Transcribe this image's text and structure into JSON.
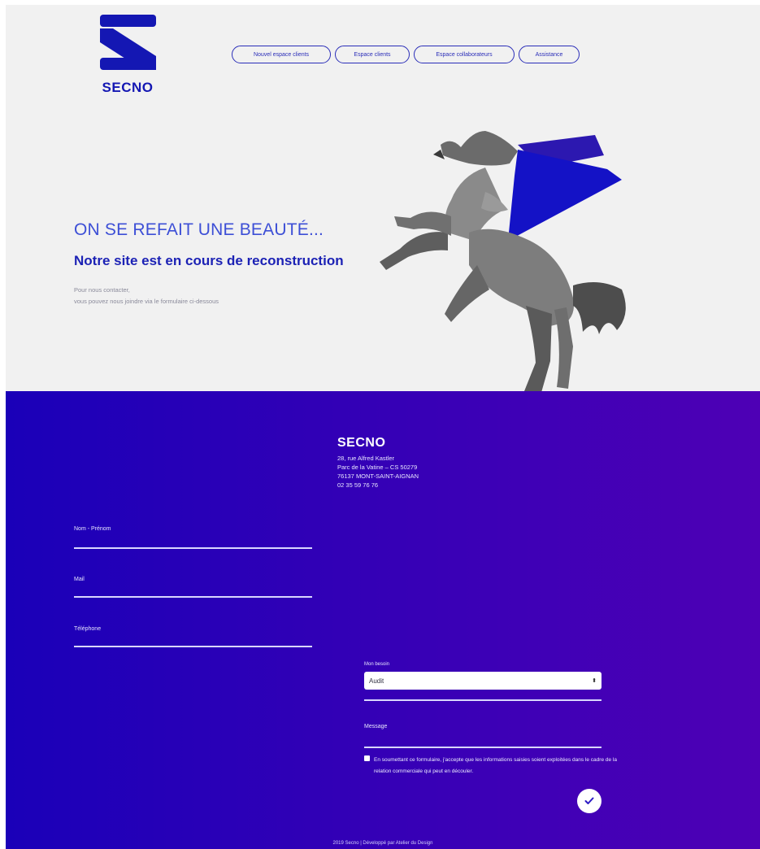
{
  "logo": {
    "text": "SECNO",
    "brand_color": "#1417b3"
  },
  "nav": {
    "items": [
      {
        "label": "Nouvel espace clients"
      },
      {
        "label": "Espace clients"
      },
      {
        "label": "Espace collaborateurs"
      },
      {
        "label": "Assistance"
      }
    ]
  },
  "hero": {
    "headline": "ON SE REFAIT UNE BEAUTÉ...",
    "subheadline": "Notre site est en cours de reconstruction",
    "intro_line1": "Pour nous contacter,",
    "intro_line2": "vous pouvez nous joindre via le formulaire ci-dessous"
  },
  "company": {
    "name": "SECNO",
    "address1": "28, rue Alfred Kastler",
    "address2": "Parc de la Vatine – CS 50279",
    "address3": "76137 MONT-SAINT-AIGNAN",
    "phone": "02 35 59 76 76"
  },
  "form": {
    "name_label": "Nom - Prénom",
    "mail_label": "Mail",
    "phone_label": "Téléphone",
    "select_label": "Mon besoin",
    "select_value": "Audit",
    "message_label": "Message",
    "consent_text": "En soumettant ce formulaire, j'accepte que les informations saisies soient exploitées dans le cadre de la relation commerciale qui peut en découler."
  },
  "footer": {
    "text": "2019 Secno | Développé par Atelier du Design"
  },
  "colors": {
    "accent": "#1417b3",
    "gradient_start": "#1a00b8",
    "gradient_end": "#4e00b5",
    "hero_bg": "#f1f1f1"
  }
}
